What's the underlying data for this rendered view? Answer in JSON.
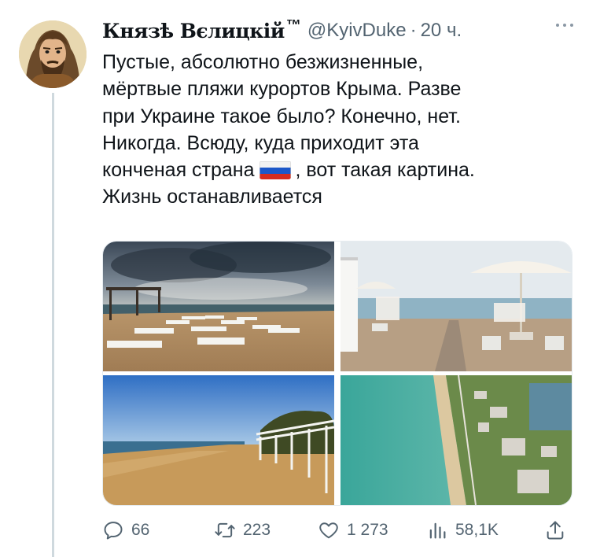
{
  "tweet": {
    "author_name": "Князѣ Вєлицкій",
    "trademark": "™",
    "handle": "@KyivDuke",
    "separator": "·",
    "time": "20 ч.",
    "text_before_flag": "Пустые, абсолютно безжизненные,\nмёртвые пляжи курортов Крыма. Разве\nпри Украине такое было? Конечно, нет.\nНикогда. Всюду, куда приходит эта\nконченая страна ",
    "flag_icon": "russia-flag-icon",
    "text_after_flag": ", вот такая картина.\nЖизнь останавливается"
  },
  "media": [
    {
      "alt": "beach-with-sunbeds-under-clouds"
    },
    {
      "alt": "beach-with-umbrellas-and-walkway"
    },
    {
      "alt": "beach-with-canopy-frames"
    },
    {
      "alt": "aerial-view-of-coast"
    }
  ],
  "actions": {
    "replies": "66",
    "retweets": "223",
    "likes": "1 273",
    "views": "58,1K"
  },
  "colors": {
    "secondary_text": "#536471",
    "thread_line": "#cfd9de"
  }
}
